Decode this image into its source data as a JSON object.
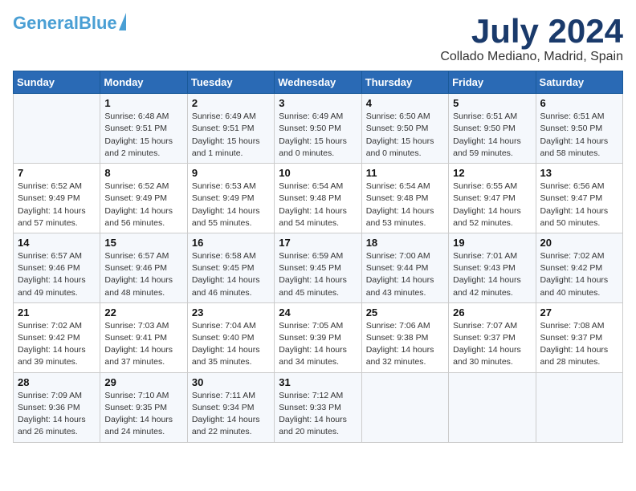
{
  "header": {
    "logo_line1": "General",
    "logo_line2": "Blue",
    "month": "July 2024",
    "location": "Collado Mediano, Madrid, Spain"
  },
  "days_of_week": [
    "Sunday",
    "Monday",
    "Tuesday",
    "Wednesday",
    "Thursday",
    "Friday",
    "Saturday"
  ],
  "weeks": [
    [
      {
        "day": "",
        "info": ""
      },
      {
        "day": "1",
        "info": "Sunrise: 6:48 AM\nSunset: 9:51 PM\nDaylight: 15 hours\nand 2 minutes."
      },
      {
        "day": "2",
        "info": "Sunrise: 6:49 AM\nSunset: 9:51 PM\nDaylight: 15 hours\nand 1 minute."
      },
      {
        "day": "3",
        "info": "Sunrise: 6:49 AM\nSunset: 9:50 PM\nDaylight: 15 hours\nand 0 minutes."
      },
      {
        "day": "4",
        "info": "Sunrise: 6:50 AM\nSunset: 9:50 PM\nDaylight: 15 hours\nand 0 minutes."
      },
      {
        "day": "5",
        "info": "Sunrise: 6:51 AM\nSunset: 9:50 PM\nDaylight: 14 hours\nand 59 minutes."
      },
      {
        "day": "6",
        "info": "Sunrise: 6:51 AM\nSunset: 9:50 PM\nDaylight: 14 hours\nand 58 minutes."
      }
    ],
    [
      {
        "day": "7",
        "info": "Sunrise: 6:52 AM\nSunset: 9:49 PM\nDaylight: 14 hours\nand 57 minutes."
      },
      {
        "day": "8",
        "info": "Sunrise: 6:52 AM\nSunset: 9:49 PM\nDaylight: 14 hours\nand 56 minutes."
      },
      {
        "day": "9",
        "info": "Sunrise: 6:53 AM\nSunset: 9:49 PM\nDaylight: 14 hours\nand 55 minutes."
      },
      {
        "day": "10",
        "info": "Sunrise: 6:54 AM\nSunset: 9:48 PM\nDaylight: 14 hours\nand 54 minutes."
      },
      {
        "day": "11",
        "info": "Sunrise: 6:54 AM\nSunset: 9:48 PM\nDaylight: 14 hours\nand 53 minutes."
      },
      {
        "day": "12",
        "info": "Sunrise: 6:55 AM\nSunset: 9:47 PM\nDaylight: 14 hours\nand 52 minutes."
      },
      {
        "day": "13",
        "info": "Sunrise: 6:56 AM\nSunset: 9:47 PM\nDaylight: 14 hours\nand 50 minutes."
      }
    ],
    [
      {
        "day": "14",
        "info": "Sunrise: 6:57 AM\nSunset: 9:46 PM\nDaylight: 14 hours\nand 49 minutes."
      },
      {
        "day": "15",
        "info": "Sunrise: 6:57 AM\nSunset: 9:46 PM\nDaylight: 14 hours\nand 48 minutes."
      },
      {
        "day": "16",
        "info": "Sunrise: 6:58 AM\nSunset: 9:45 PM\nDaylight: 14 hours\nand 46 minutes."
      },
      {
        "day": "17",
        "info": "Sunrise: 6:59 AM\nSunset: 9:45 PM\nDaylight: 14 hours\nand 45 minutes."
      },
      {
        "day": "18",
        "info": "Sunrise: 7:00 AM\nSunset: 9:44 PM\nDaylight: 14 hours\nand 43 minutes."
      },
      {
        "day": "19",
        "info": "Sunrise: 7:01 AM\nSunset: 9:43 PM\nDaylight: 14 hours\nand 42 minutes."
      },
      {
        "day": "20",
        "info": "Sunrise: 7:02 AM\nSunset: 9:42 PM\nDaylight: 14 hours\nand 40 minutes."
      }
    ],
    [
      {
        "day": "21",
        "info": "Sunrise: 7:02 AM\nSunset: 9:42 PM\nDaylight: 14 hours\nand 39 minutes."
      },
      {
        "day": "22",
        "info": "Sunrise: 7:03 AM\nSunset: 9:41 PM\nDaylight: 14 hours\nand 37 minutes."
      },
      {
        "day": "23",
        "info": "Sunrise: 7:04 AM\nSunset: 9:40 PM\nDaylight: 14 hours\nand 35 minutes."
      },
      {
        "day": "24",
        "info": "Sunrise: 7:05 AM\nSunset: 9:39 PM\nDaylight: 14 hours\nand 34 minutes."
      },
      {
        "day": "25",
        "info": "Sunrise: 7:06 AM\nSunset: 9:38 PM\nDaylight: 14 hours\nand 32 minutes."
      },
      {
        "day": "26",
        "info": "Sunrise: 7:07 AM\nSunset: 9:37 PM\nDaylight: 14 hours\nand 30 minutes."
      },
      {
        "day": "27",
        "info": "Sunrise: 7:08 AM\nSunset: 9:37 PM\nDaylight: 14 hours\nand 28 minutes."
      }
    ],
    [
      {
        "day": "28",
        "info": "Sunrise: 7:09 AM\nSunset: 9:36 PM\nDaylight: 14 hours\nand 26 minutes."
      },
      {
        "day": "29",
        "info": "Sunrise: 7:10 AM\nSunset: 9:35 PM\nDaylight: 14 hours\nand 24 minutes."
      },
      {
        "day": "30",
        "info": "Sunrise: 7:11 AM\nSunset: 9:34 PM\nDaylight: 14 hours\nand 22 minutes."
      },
      {
        "day": "31",
        "info": "Sunrise: 7:12 AM\nSunset: 9:33 PM\nDaylight: 14 hours\nand 20 minutes."
      },
      {
        "day": "",
        "info": ""
      },
      {
        "day": "",
        "info": ""
      },
      {
        "day": "",
        "info": ""
      }
    ]
  ]
}
